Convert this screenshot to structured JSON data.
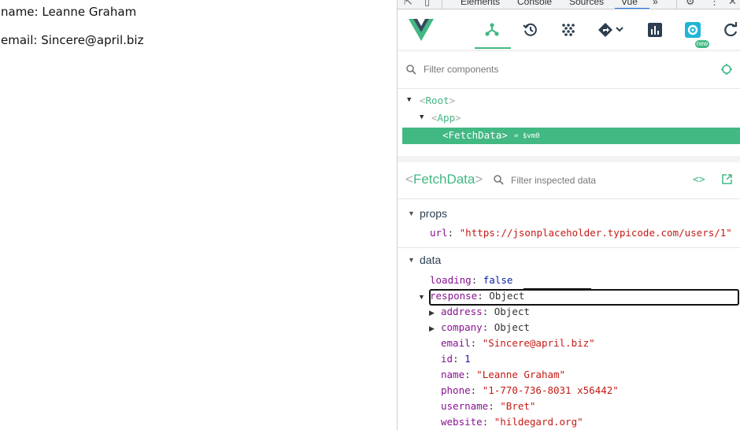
{
  "page": {
    "name_line": "name: Leanne Graham",
    "email_line": "email: Sincere@april.biz"
  },
  "devtools_tabs": {
    "items": [
      "Elements",
      "Console",
      "Sources",
      "Vue"
    ],
    "more": "»",
    "active": "Vue"
  },
  "vue_toolbar": {
    "tools": [
      "components-icon",
      "timeline-icon",
      "vuex-icon",
      "router-icon",
      "performance-icon",
      "settings-icon",
      "refresh-icon"
    ],
    "active_tool": "components-icon",
    "new_badge": "new",
    "accent": "#42b883"
  },
  "component_filter": {
    "placeholder": "Filter components"
  },
  "component_tree": {
    "rows": [
      {
        "name": "Root",
        "expanded": true,
        "selected": false
      },
      {
        "name": "App",
        "expanded": true,
        "selected": false
      },
      {
        "name": "FetchData",
        "selected": true,
        "vm": "= $vm0"
      }
    ]
  },
  "inspector": {
    "component": "FetchData",
    "filter_placeholder": "Filter inspected data",
    "sections": {
      "props": {
        "label": "props",
        "url_key": "url",
        "url_value": "\"https://jsonplaceholder.typicode.com/users/1\""
      },
      "data": {
        "label": "data",
        "loading_key": "loading",
        "loading_value": "false",
        "response_key": "response",
        "response_value": "Object",
        "children": {
          "address": {
            "key": "address",
            "value": "Object"
          },
          "company": {
            "key": "company",
            "value": "Object"
          },
          "email": {
            "key": "email",
            "value": "\"Sincere@april.biz\""
          },
          "id": {
            "key": "id",
            "value": "1"
          },
          "name": {
            "key": "name",
            "value": "\"Leanne Graham\""
          },
          "phone": {
            "key": "phone",
            "value": "\"1-770-736-8031 x56442\""
          },
          "username": {
            "key": "username",
            "value": "\"Bret\""
          },
          "website": {
            "key": "website",
            "value": "\"hildegard.org\""
          }
        }
      }
    }
  }
}
